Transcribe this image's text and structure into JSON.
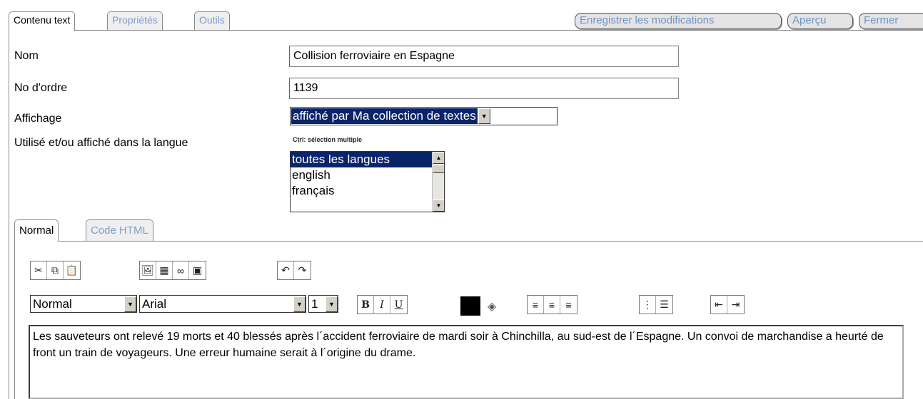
{
  "tabs": [
    "Contenu text",
    "Propriétés",
    "Outils"
  ],
  "actions": {
    "save": "Enregistrer les modifications",
    "preview": "Aperçu",
    "close": "Fermer"
  },
  "form": {
    "name_label": "Nom",
    "name_value": "Collision ferroviaire en Espagne",
    "order_label": "No d'ordre",
    "order_value": "1139",
    "display_label": "Affichage",
    "display_value": "affiché par Ma collection de textes",
    "language_label": "Utilisé et/ou affiché dans la langue",
    "language_hint": "Ctrl: sélection multiple",
    "language_options": [
      "toutes les langues",
      "english",
      "français"
    ],
    "language_selected": "toutes les langues"
  },
  "editor": {
    "tabs": [
      "Normal",
      "Code HTML"
    ],
    "toolbar_row1": {
      "clipboard": [
        "cut-icon",
        "copy-icon",
        "paste-icon"
      ],
      "insert": [
        "image-icon",
        "table-icon",
        "link-icon",
        "insert-object-icon"
      ],
      "history": [
        "undo-icon",
        "redo-icon"
      ]
    },
    "format_value": "Normal",
    "font_value": "Arial",
    "size_value": "1",
    "bold": "B",
    "italic": "I",
    "underline": "U",
    "text_color": "#000000",
    "content": "Les sauveteurs ont relevé 19 morts et 40 blessés après l´accident ferroviaire de mardi soir à Chinchilla, au sud-est de l´Espagne. Un convoi de marchandise a heurté de front un train de voyageurs. Une erreur humaine serait à l´origine du drame."
  }
}
